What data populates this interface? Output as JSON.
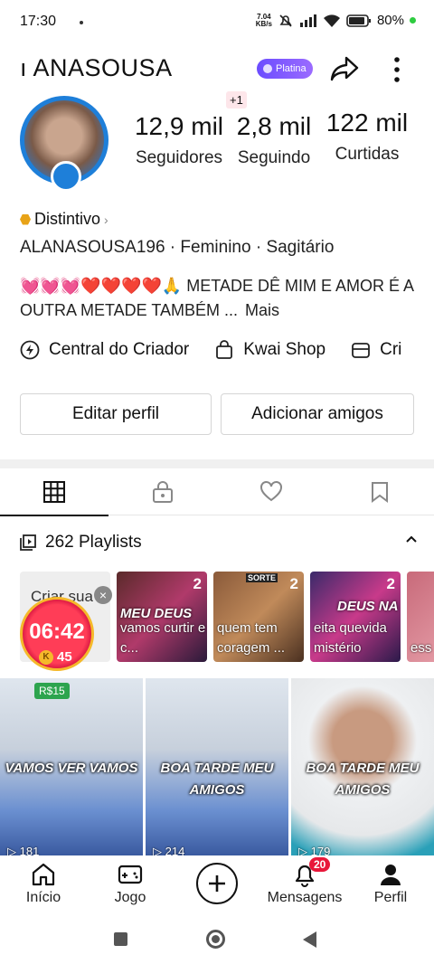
{
  "status_bar": {
    "time": "17:30",
    "net_speed_value": "7.04",
    "net_speed_unit": "KB/s",
    "battery": "80%"
  },
  "header": {
    "username": "ANASOUSA",
    "username_prefix": "ı",
    "tier_badge": "Platina"
  },
  "profile": {
    "plus_one": "+1",
    "followers_count": "12,9 mil",
    "followers_label": "Seguidores",
    "following_count": "2,8 mil",
    "following_label": "Seguindo",
    "likes_count": "122 mil",
    "likes_label": "Curtidas",
    "distintivo": "Distintivo",
    "info": "ALANASOUSA196 · Feminino · Sagitário",
    "bio": "💓💓💓❤️❤️❤️❤️🙏 METADE DÊ MIM E AMOR É A OUTRA METADE TAMBÉM ...",
    "bio_more": "Mais"
  },
  "shortcuts": [
    {
      "label": "Central do Criador",
      "icon": "bolt-icon"
    },
    {
      "label": "Kwai Shop",
      "icon": "bag-icon"
    },
    {
      "label": "Cri",
      "icon": "store-icon"
    }
  ],
  "buttons": {
    "edit_profile": "Editar perfil",
    "add_friends": "Adicionar amigos"
  },
  "playlists": {
    "title": "262 Playlists",
    "create_label": "Criar sua",
    "items": [
      {
        "count": "2",
        "caption": "vamos curtir e c...",
        "overlay": "MEU DEUS"
      },
      {
        "count": "2",
        "caption": "quem tem coragem ...",
        "overlay": "SORTE"
      },
      {
        "count": "2",
        "caption": "eita quevida mistério",
        "overlay": "DEUS NA"
      },
      {
        "count": "",
        "caption": "ess a m",
        "overlay": ""
      }
    ]
  },
  "timer": {
    "time": "06:42",
    "coin_letter": "K",
    "coins": "45"
  },
  "videos": [
    {
      "caption": "VAMOS VER VAMOS",
      "views": "181",
      "reward": "R$15"
    },
    {
      "caption": "BOA TARDE MEU AMIGOS",
      "views": "214"
    },
    {
      "caption": "BOA TARDE MEU AMIGOS",
      "views": "179"
    }
  ],
  "bottom_nav": {
    "home": "Início",
    "game": "Jogo",
    "messages": "Mensagens",
    "messages_badge": "20",
    "profile": "Perfil"
  },
  "colors": {
    "platina_badge": "#7b5cff",
    "avatar_ring": "#1e7fd9",
    "notification": "#e8173a"
  }
}
